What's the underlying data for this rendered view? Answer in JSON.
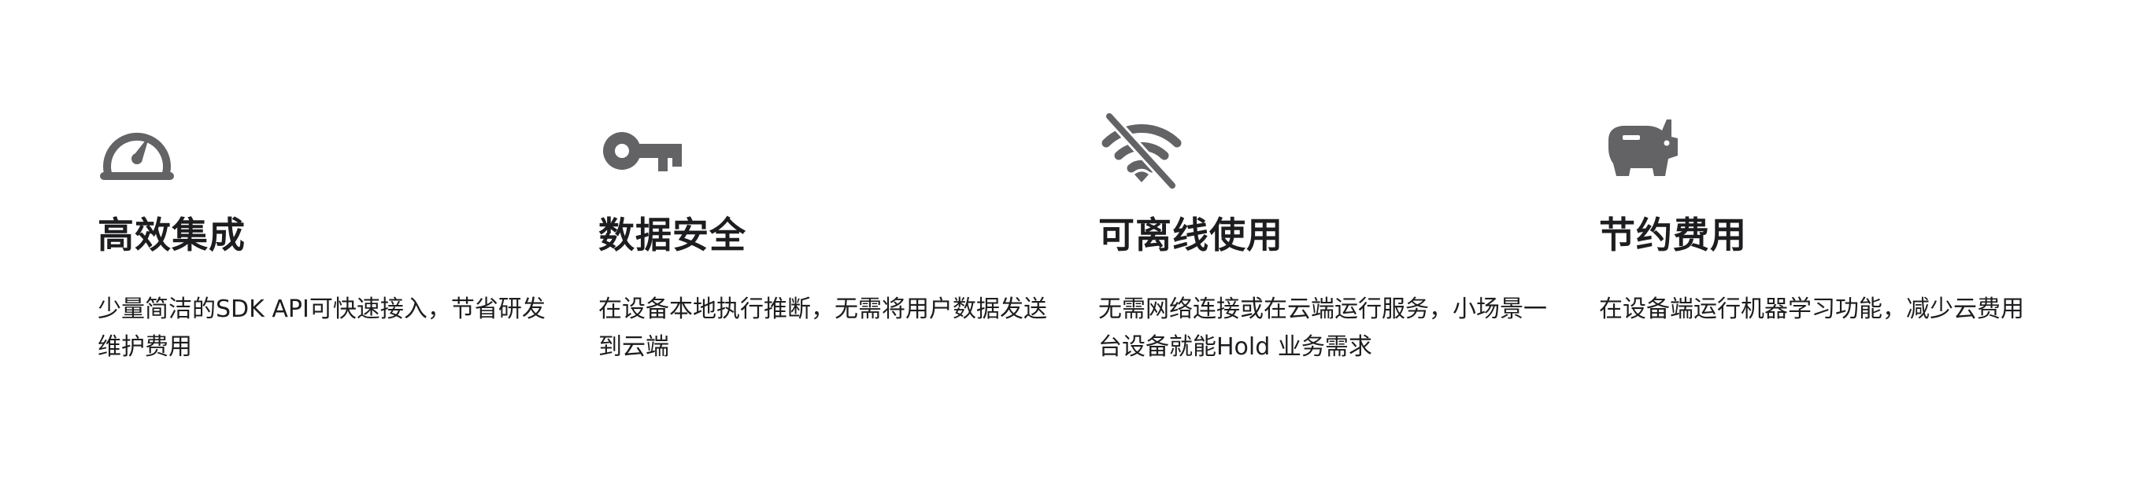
{
  "colors": {
    "icon": "#636366",
    "text": "#1d1d1f",
    "background": "#ffffff"
  },
  "features": [
    {
      "icon": "speedometer-icon",
      "title": "高效集成",
      "description": "少量简洁的SDK API可快速接入，节省研发维护费用"
    },
    {
      "icon": "key-icon",
      "title": "数据安全",
      "description": "在设备本地执行推断，无需将用户数据发送到云端"
    },
    {
      "icon": "wifi-off-icon",
      "title": "可离线使用",
      "description": "无需网络连接或在云端运行服务，小场景一台设备就能Hold 业务需求"
    },
    {
      "icon": "piggy-bank-icon",
      "title": "节约费用",
      "description": "在设备端运行机器学习功能，减少云费用"
    }
  ]
}
